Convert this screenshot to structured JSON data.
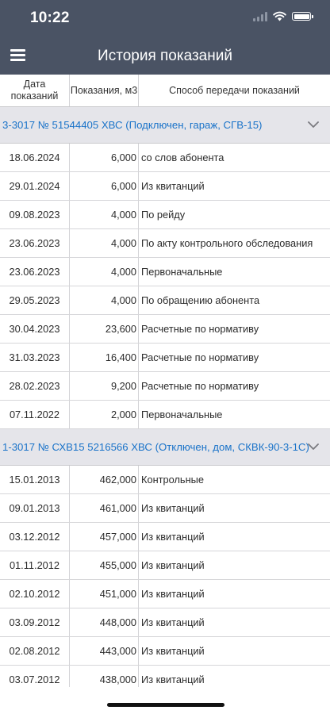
{
  "status": {
    "time": "10:22"
  },
  "header": {
    "title": "История показаний"
  },
  "columns": {
    "date": "Дата показаний",
    "reading": "Показания, м3",
    "method": "Способ передачи показаний"
  },
  "groups": [
    {
      "label": "3-3017 № 51544405 ХВС (Подключен, гараж, СГВ-15)",
      "rows": [
        {
          "date": "18.06.2024",
          "value": "6,000",
          "method": "со слов абонента"
        },
        {
          "date": "29.01.2024",
          "value": "6,000",
          "method": "Из квитанций"
        },
        {
          "date": "09.08.2023",
          "value": "4,000",
          "method": "По рейду"
        },
        {
          "date": "23.06.2023",
          "value": "4,000",
          "method": "По акту контрольного обследования"
        },
        {
          "date": "23.06.2023",
          "value": "4,000",
          "method": "Первоначальные"
        },
        {
          "date": "29.05.2023",
          "value": "4,000",
          "method": "По обращению абонента"
        },
        {
          "date": "30.04.2023",
          "value": "23,600",
          "method": "Расчетные по нормативу"
        },
        {
          "date": "31.03.2023",
          "value": "16,400",
          "method": "Расчетные по нормативу"
        },
        {
          "date": "28.02.2023",
          "value": "9,200",
          "method": "Расчетные по нормативу"
        },
        {
          "date": "07.11.2022",
          "value": "2,000",
          "method": "Первоначальные"
        }
      ]
    },
    {
      "label": "1-3017 № СХВ15 5216566 ХВС (Отключен, дом, СКВК-90-3-1С)",
      "rows": [
        {
          "date": "15.01.2013",
          "value": "462,000",
          "method": "Контрольные"
        },
        {
          "date": "09.01.2013",
          "value": "461,000",
          "method": "Из квитанций"
        },
        {
          "date": "03.12.2012",
          "value": "457,000",
          "method": "Из квитанций"
        },
        {
          "date": "01.11.2012",
          "value": "455,000",
          "method": "Из квитанций"
        },
        {
          "date": "02.10.2012",
          "value": "451,000",
          "method": "Из квитанций"
        },
        {
          "date": "03.09.2012",
          "value": "448,000",
          "method": "Из квитанций"
        },
        {
          "date": "02.08.2012",
          "value": "443,000",
          "method": "Из квитанций"
        },
        {
          "date": "03.07.2012",
          "value": "438,000",
          "method": "Из квитанций"
        }
      ]
    }
  ],
  "icons": {
    "menu": "hamburger-menu-icon",
    "chevron": "chevron-down-icon"
  },
  "colors": {
    "header_bg": "#4a5364",
    "group_bg": "#e5e5ea",
    "link": "#1a73c9"
  }
}
